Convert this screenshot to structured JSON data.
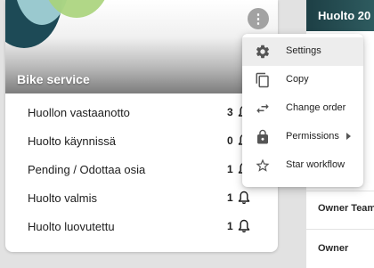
{
  "card": {
    "title": "Bike service",
    "rows": [
      {
        "label": "Huollon vastaanotto",
        "count": "3"
      },
      {
        "label": "Huolto käynnissä",
        "count": "0"
      },
      {
        "label": "Pending / Odottaa osia",
        "count": "1"
      },
      {
        "label": "Huolto valmis",
        "count": "1"
      },
      {
        "label": "Huolto luovutettu",
        "count": "1"
      }
    ]
  },
  "menu": {
    "items": [
      {
        "label": "Settings",
        "icon": "gear-icon"
      },
      {
        "label": "Copy",
        "icon": "copy-icon"
      },
      {
        "label": "Change order",
        "icon": "swap-arrows-icon"
      },
      {
        "label": "Permissions",
        "icon": "lock-icon"
      },
      {
        "label": "Star workflow",
        "icon": "star-icon"
      }
    ]
  },
  "side_panel": {
    "title": "Huolto 20",
    "fields": [
      "Owner Team",
      "Owner"
    ]
  },
  "colors": {
    "header_dark": "#1d4a56",
    "header_light_blue": "#a8d7dd",
    "header_green": "#a9d37a",
    "side_header": "#1d3f45",
    "menu_active": "#ededed"
  }
}
